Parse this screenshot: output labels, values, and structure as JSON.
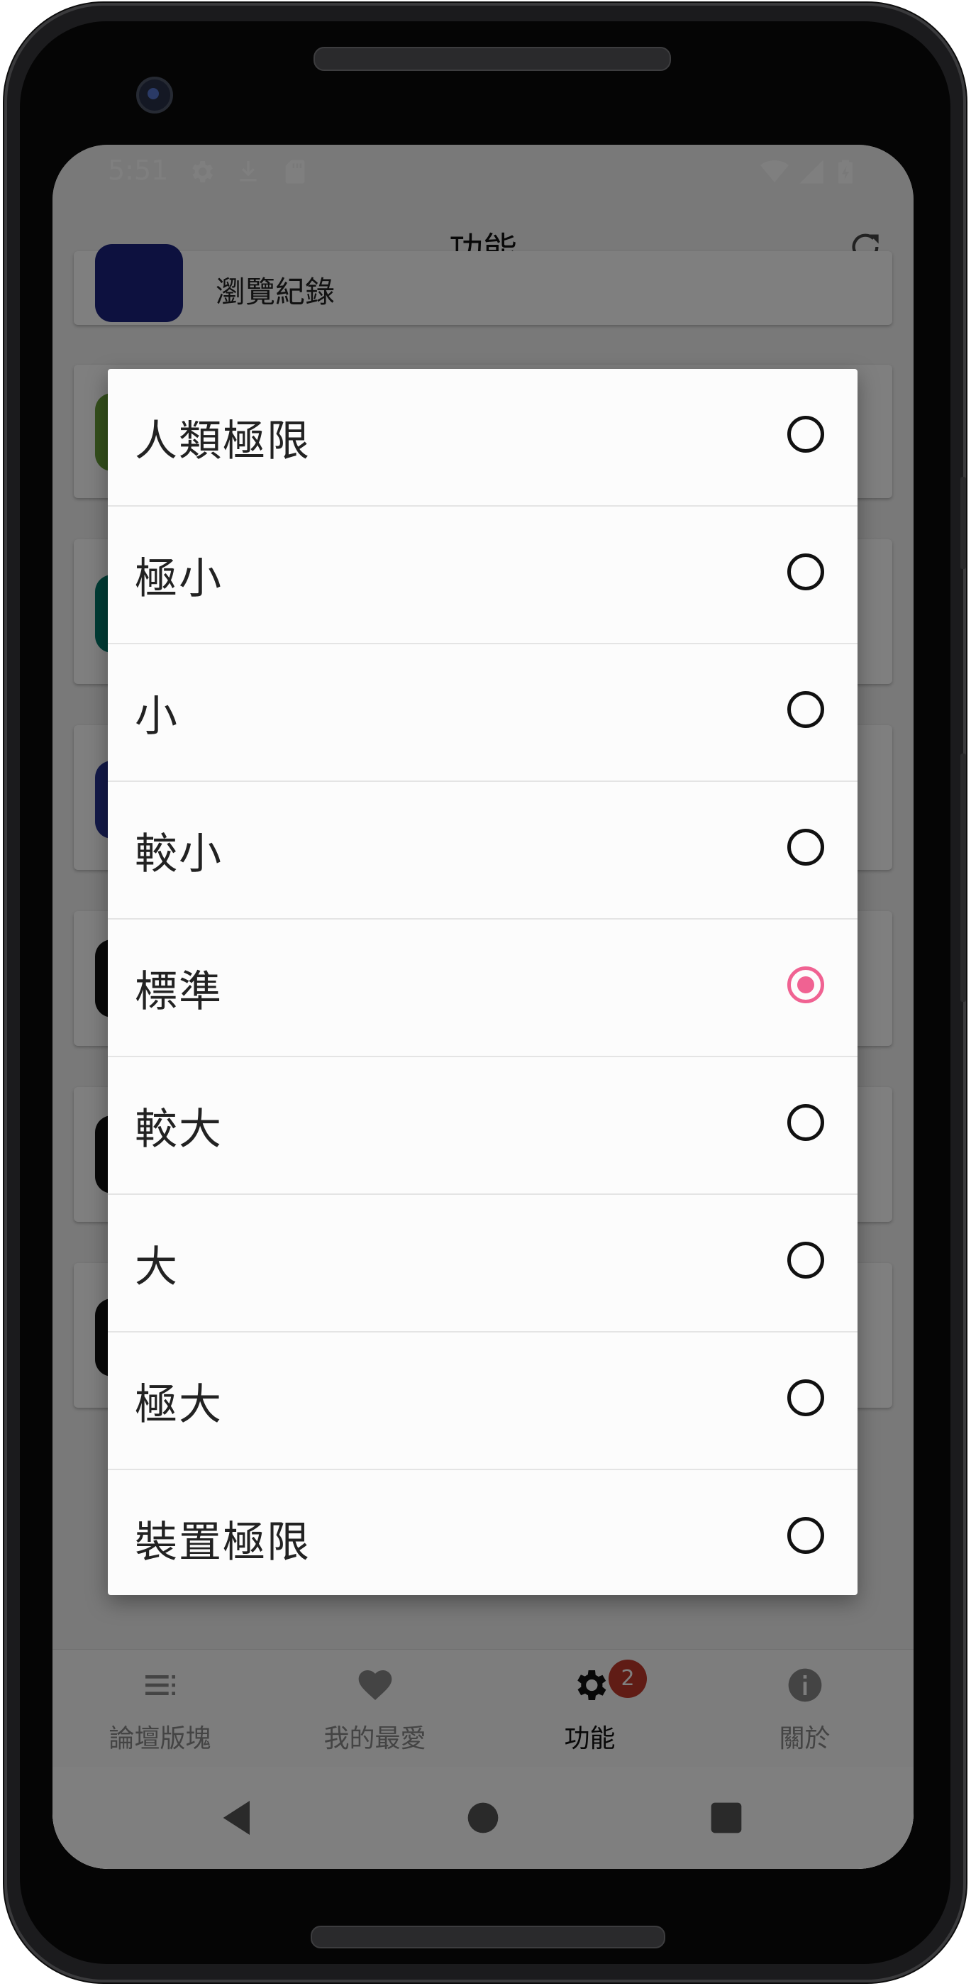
{
  "status_bar": {
    "time": "5:51",
    "left_icons": [
      "gear-icon",
      "download-icon",
      "sd-card-icon"
    ],
    "right_icons": [
      "wifi-icon",
      "signal-icon",
      "battery-charging-icon"
    ]
  },
  "app_bar": {
    "title": "功能",
    "action_icon": "refresh-icon"
  },
  "background_list": {
    "first_item_label": "瀏覽紀錄",
    "icon_colors": [
      "#1a237e",
      "#689f38",
      "#00796b",
      "#283593",
      "#111111",
      "#111111",
      "#111111"
    ]
  },
  "dialog": {
    "options": [
      {
        "label": "人類極限",
        "selected": false
      },
      {
        "label": "極小",
        "selected": false
      },
      {
        "label": "小",
        "selected": false
      },
      {
        "label": "較小",
        "selected": false
      },
      {
        "label": "標準",
        "selected": true
      },
      {
        "label": "較大",
        "selected": false
      },
      {
        "label": "大",
        "selected": false
      },
      {
        "label": "極大",
        "selected": false
      },
      {
        "label": "裝置極限",
        "selected": false
      }
    ],
    "accent_color": "#f06292"
  },
  "bottom_nav": {
    "items": [
      {
        "label": "論壇版塊",
        "icon": "list-icon",
        "active": false
      },
      {
        "label": "我的最愛",
        "icon": "heart-icon",
        "active": false
      },
      {
        "label": "功能",
        "icon": "gear-icon",
        "active": true,
        "badge": "2"
      },
      {
        "label": "關於",
        "icon": "info-icon",
        "active": false
      }
    ]
  },
  "system_nav": {
    "icons": [
      "back-icon",
      "home-icon",
      "recents-icon"
    ]
  }
}
